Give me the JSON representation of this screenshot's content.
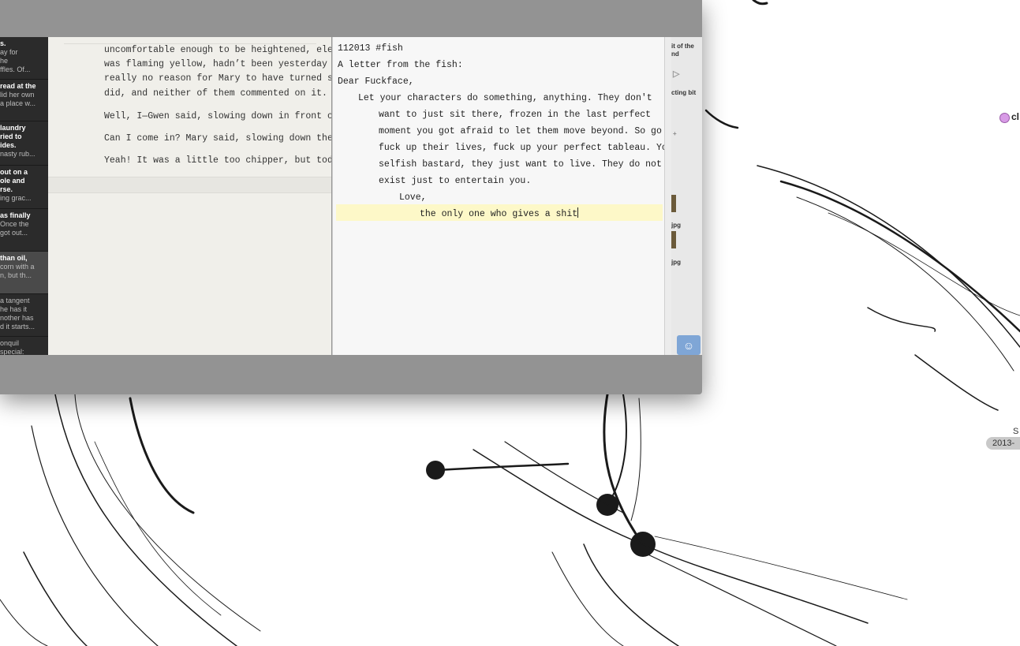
{
  "sidebar": {
    "items": [
      {
        "title": "s.",
        "lines": [
          "ay for",
          "he",
          "ffles. Of..."
        ]
      },
      {
        "title": "read at the",
        "lines": [
          "",
          "lid her own",
          "a place w..."
        ]
      },
      {
        "title": "laundry",
        "lines": [
          "ried to",
          "ides.",
          "nasty rub..."
        ]
      },
      {
        "title": "out on a",
        "lines": [
          "ole and",
          "rse.",
          "ing grac..."
        ]
      },
      {
        "title": "as finally",
        "lines": [
          "",
          "Once the",
          "got out..."
        ]
      },
      {
        "title": "than oil,",
        "lines": [
          "",
          "corn with a",
          "n, but th..."
        ]
      },
      {
        "title": "",
        "lines": [
          "a tangent",
          "he has it",
          "nother has",
          "d it starts..."
        ]
      },
      {
        "title": "",
        "lines": [
          "onquil",
          "special:"
        ]
      }
    ]
  },
  "document": {
    "paragraphs": [
      "uncomfortable enough to be heightened, electr",
      "was flaming yellow, hadn’t been yesterday at",
      "really no reason for Mary to have turned sout",
      "did, and neither of them commented on it.",
      "Well, I—Gwen said, slowing down in front of h",
      "Can I come in? Mary said, slowing down the en",
      "Yeah! It was a little too chipper, but today"
    ]
  },
  "note": {
    "lines": [
      "112013 #fish",
      "A letter from the fish:",
      "Dear Fuckface,",
      "Let your characters do something, anything. They don't",
      "want to just sit there, frozen in the last perfect",
      "moment you got afraid to let them move beyond. So go",
      "fuck up their lives, fuck up your perfect tableau. You",
      "selfish bastard, they just want to live. They do not",
      "exist just to entertain you.",
      "Love,",
      "the only one who gives a shit"
    ]
  },
  "right_strip": {
    "labels": [
      "it of the",
      "nd",
      "cting bit",
      "jpg",
      "jpg"
    ]
  },
  "desktop": {
    "dot_label": "cl",
    "badge_top": "S",
    "badge_label": "2013-",
    "dot_color": "#d89be6"
  }
}
